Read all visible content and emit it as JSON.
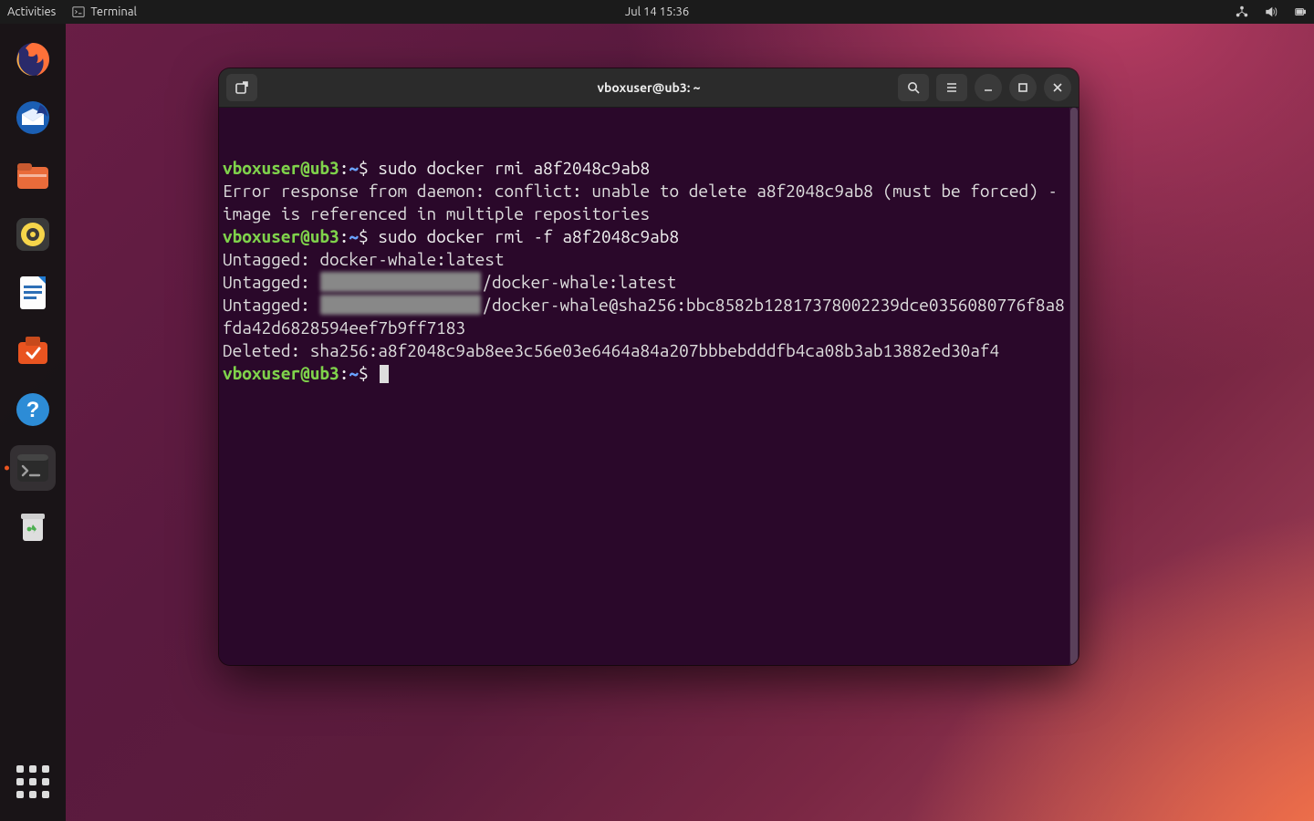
{
  "topbar": {
    "activities": "Activities",
    "app_label": "Terminal",
    "datetime": "Jul 14  15:36",
    "status_icons": [
      "network-wired-icon",
      "volume-icon",
      "battery-icon"
    ]
  },
  "dock": {
    "items": [
      {
        "name": "firefox",
        "active": false
      },
      {
        "name": "thunderbird",
        "active": false
      },
      {
        "name": "files",
        "active": false
      },
      {
        "name": "rhythmbox",
        "active": false
      },
      {
        "name": "libreoffice-writer",
        "active": false
      },
      {
        "name": "ubuntu-software",
        "active": false
      },
      {
        "name": "help",
        "active": false
      },
      {
        "name": "terminal",
        "active": true
      },
      {
        "name": "trash",
        "active": false
      }
    ]
  },
  "terminal": {
    "title": "vboxuser@ub3: ~",
    "prompt": {
      "user": "vboxuser",
      "host": "ub3",
      "path": "~",
      "symbol": "$"
    },
    "lines": [
      {
        "type": "cmd",
        "text": "sudo docker rmi a8f2048c9ab8"
      },
      {
        "type": "out",
        "text": "Error response from daemon: conflict: unable to delete a8f2048c9ab8 (must be forced) - image is referenced in multiple repositories"
      },
      {
        "type": "cmd",
        "text": "sudo docker rmi -f a8f2048c9ab8"
      },
      {
        "type": "out",
        "text": "Untagged: docker-whale:latest"
      },
      {
        "type": "out-redact",
        "prefix": "Untagged: ",
        "suffix": "/docker-whale:latest"
      },
      {
        "type": "out-redact",
        "prefix": "Untagged: ",
        "suffix": "/docker-whale@sha256:bbc8582b12817378002239dce0356080776f8a8fda42d6828594eef7b9ff7183"
      },
      {
        "type": "out",
        "text": "Deleted: sha256:a8f2048c9ab8ee3c56e03e6464a84a207bbbebdddfb4ca08b3ab13882ed30af4"
      },
      {
        "type": "cmd",
        "text": "",
        "cursor": true
      }
    ]
  }
}
